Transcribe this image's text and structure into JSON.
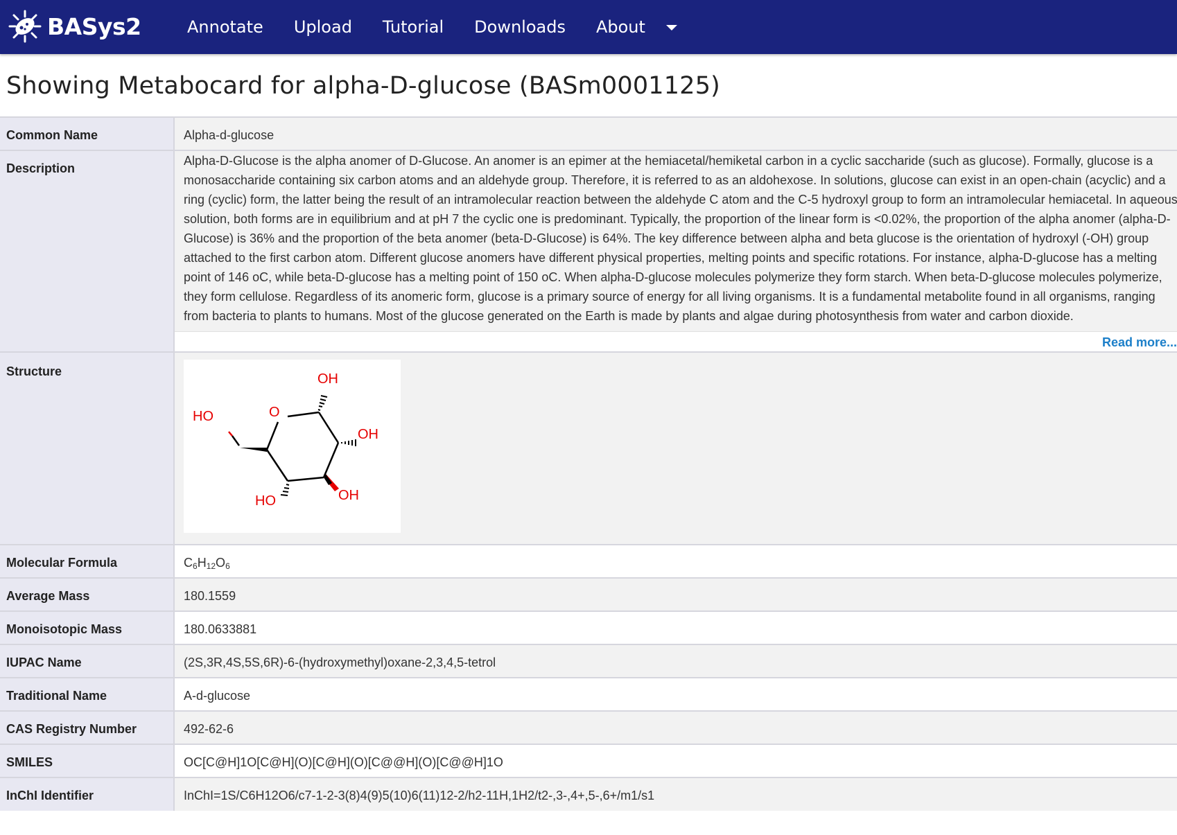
{
  "brand": {
    "name": "BASys2"
  },
  "nav": {
    "items": [
      "Annotate",
      "Upload",
      "Tutorial",
      "Downloads",
      "About"
    ]
  },
  "page": {
    "title": "Showing Metabocard for alpha-D-glucose (BASm0001125)"
  },
  "card": {
    "common_name": {
      "label": "Common Name",
      "value": "Alpha-d-glucose"
    },
    "description": {
      "label": "Description",
      "text": "Alpha-D-Glucose is the alpha anomer of D-Glucose. An anomer is an epimer at the hemiacetal/hemiketal carbon in a cyclic saccharide (such as glucose). Formally, glucose is a monosaccharide containing six carbon atoms and an aldehyde group. Therefore, it is referred to as an aldohexose. In solutions, glucose can exist in an open-chain (acyclic) and a ring (cyclic) form, the latter being the result of an intramolecular reaction between the aldehyde C atom and the C-5 hydroxyl group to form an intramolecular hemiacetal. In aqueous solution, both forms are in equilibrium and at pH 7 the cyclic one is predominant. Typically, the proportion of the linear form is <0.02%, the proportion of the alpha anomer (alpha-D-Glucose) is 36% and the proportion of the beta anomer (beta-D-Glucose) is 64%. The key difference between alpha and beta glucose is the orientation of hydroxyl (-OH) group attached to the first carbon atom. Different glucose anomers have different physical properties, melting points and specific rotations. For instance, alpha-D-glucose has a melting point of 146 oC, while beta-D-glucose has a melting point of 150 oC. When alpha-D-glucose molecules polymerize they form starch. When beta-D-glucose molecules polymerize, they form cellulose. Regardless of its anomeric form, glucose is a primary source of energy for all living organisms. It is a fundamental metabolite found in all organisms, ranging from bacteria to plants to humans. Most of the glucose generated on the Earth is made by plants and algae during photosynthesis from water and carbon dioxide.",
      "read_more": "Read more..."
    },
    "structure": {
      "label": "Structure",
      "atom_labels": {
        "oh_top": "OH",
        "o_ring": "O",
        "ho_left": "HO",
        "oh_right": "OH",
        "ho_bottom": "HO",
        "oh_bottom": "OH"
      },
      "colors": {
        "oxygen": "#e60000",
        "bond": "#000000"
      }
    },
    "molecular_formula": {
      "label": "Molecular Formula",
      "c": "C",
      "c_n": "6",
      "h": "H",
      "h_n": "12",
      "o": "O",
      "o_n": "6"
    },
    "average_mass": {
      "label": "Average Mass",
      "value": "180.1559"
    },
    "monoisotopic_mass": {
      "label": "Monoisotopic Mass",
      "value": "180.0633881"
    },
    "iupac_name": {
      "label": "IUPAC Name",
      "value": "(2S,3R,4S,5S,6R)-6-(hydroxymethyl)oxane-2,3,4,5-tetrol"
    },
    "traditional_name": {
      "label": "Traditional Name",
      "value": "A-d-glucose"
    },
    "cas": {
      "label": "CAS Registry Number",
      "value": "492-62-6"
    },
    "smiles": {
      "label": "SMILES",
      "value": "OC[C@H]1O[C@H](O)[C@H](O)[C@@H](O)[C@@H]1O"
    },
    "inchi": {
      "label": "InChI Identifier",
      "value": "InChI=1S/C6H12O6/c7-1-2-3(8)4(9)5(10)6(11)12-2/h2-11H,1H2/t2-,3-,4+,5-,6+/m1/s1"
    }
  },
  "colors": {
    "navbar": "#1a237e",
    "link": "#1c7fc9",
    "label_bg": "#e8e8f2"
  }
}
